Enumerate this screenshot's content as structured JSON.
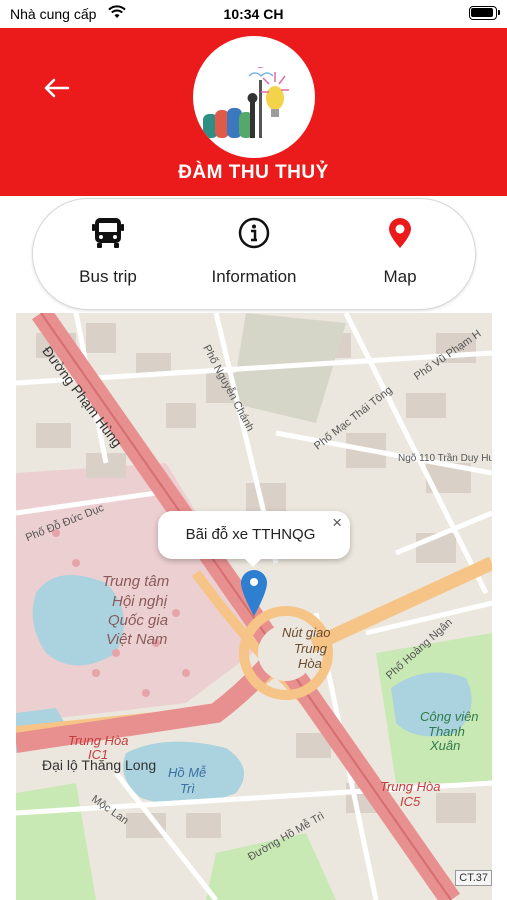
{
  "status_bar": {
    "carrier": "Nhà cung cấp",
    "time": "10:34 CH"
  },
  "header": {
    "title": "ĐÀM THU THUỶ"
  },
  "tabs": [
    {
      "label": "Bus trip",
      "icon": "bus-icon"
    },
    {
      "label": "Information",
      "icon": "info-icon"
    },
    {
      "label": "Map",
      "icon": "map-pin-icon"
    }
  ],
  "map": {
    "popup_text": "Bãi đỗ xe TTHNQG",
    "popup_close": "×",
    "labels": {
      "pham_hung": "Đường Phạm Hùng",
      "trung_tam": "Trung tâm",
      "hoi_nghi": "Hội nghị",
      "quoc_gia": "Quốc gia",
      "viet_nam": "Việt Nam",
      "nut_giao": "Nút giao",
      "trung_hoa": "Trung",
      "hoa": "Hòa",
      "trung_hoa_ic1": "Trung Hòa",
      "ic1": "IC1",
      "dai_lo": "Đại lộ Thăng Long",
      "ho_me_tri": "Hồ Mễ",
      "tri": "Trì",
      "cong_vien": "Công viên",
      "thanh": "Thanh",
      "xuan": "Xuân",
      "trung_hoa_ic5": "Trung Hòa",
      "ic5": "IC5",
      "pho_do_duc_duc": "Phố Đỗ Đức Dục",
      "pho_nguyen_chanh": "Phố Nguyễn Chánh",
      "pho_mac_thai_tong": "Phố Mạc Thái Tông",
      "ngo_110": "Ngõ 110 Trần Duy Hư",
      "pho_vu_pham": "Phố Vũ Phạm H",
      "pho_hoang_ngan": "Phố Hoàng Ngân",
      "moc_lan": "Mộc Lan",
      "pho_do_ho_me_tri": "Đường Hồ Mễ Trì",
      "ct37": "CT.37"
    },
    "colors": {
      "motorway": "#e88f8f",
      "primary": "#f7c487",
      "water": "#aad3df",
      "park": "#c8e8b4",
      "pink_area": "#eccfd0"
    }
  },
  "colors": {
    "accent": "#ec1b1b",
    "map_pin": "#2e7fd0"
  }
}
